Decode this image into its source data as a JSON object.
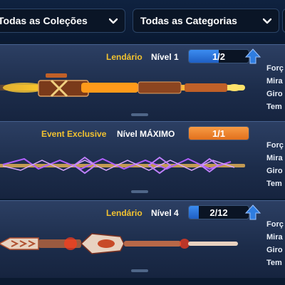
{
  "filters": {
    "collections": {
      "label": "Todas as Coleções",
      "icon": "chevron-down-icon"
    },
    "categories": {
      "label": "Todas as Categorias",
      "icon": "chevron-down-icon"
    }
  },
  "cues": [
    {
      "rarity": "Lendário",
      "level": "Nível 1",
      "progress_text": "1/2",
      "progress": 0.5,
      "progress_color": "#2f7de0",
      "rarity_color": "#f2c230",
      "upgrade_icon": "up-arrow-icon",
      "stats": [
        "Forç",
        "Mira",
        "Giro",
        "Tem"
      ]
    },
    {
      "rarity": "Event Exclusive",
      "level": "Nível MÁXIMO",
      "progress_text": "1/1",
      "progress": 1.0,
      "progress_color": "#f08a32",
      "rarity_color": "#f2c230",
      "stats": [
        "Forç",
        "Mira",
        "Giro",
        "Tem"
      ]
    },
    {
      "rarity": "Lendário",
      "level": "Nível 4",
      "progress_text": "2/12",
      "progress": 0.1667,
      "progress_color": "#2f7de0",
      "rarity_color": "#f2c230",
      "upgrade_icon": "up-arrow-icon",
      "stats": [
        "Forç",
        "Mira",
        "Giro",
        "Tem"
      ]
    }
  ]
}
